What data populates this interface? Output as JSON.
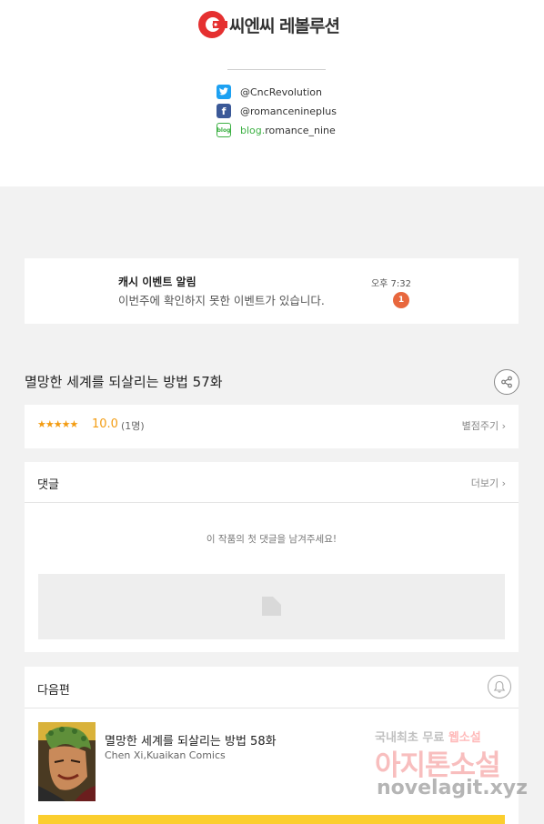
{
  "header": {
    "logo_text": "씨엔씨 레볼루션",
    "social": [
      {
        "icon": "twitter-icon",
        "handle": "@CncRevolution"
      },
      {
        "icon": "facebook-icon",
        "handle": "@romanceninepIus"
      },
      {
        "icon": "blog-icon",
        "prefix": "blog.",
        "handle": "romance_nine"
      }
    ],
    "blog_icon_label": "blog"
  },
  "notification": {
    "title": "캐시 이벤트 알림",
    "body": "이번주에 확인하지 못한 이벤트가 있습니다.",
    "time": "오후 7:32",
    "badge": "1"
  },
  "episode": {
    "title": "멸망한 세계를 되살리는 방법 57화"
  },
  "rating": {
    "stars": "★★★★★",
    "score": "10.0",
    "count": "(1명)",
    "rate_label": "별점주기 ›"
  },
  "comments": {
    "title": "댓글",
    "more_label": "더보기 ›",
    "empty_message": "이 작품의 첫 댓글을 남겨주세요!"
  },
  "next_episode": {
    "section_title": "다음편",
    "title": "멸망한 세계를 되살리는 방법 58화",
    "authors": "Chen Xi,Kuaikan Comics"
  },
  "watermark": {
    "line1_a": "국내최초 무료",
    "line1_b": "웹소설",
    "line2": "아지톤소설",
    "line3": "novelagit.xyz"
  },
  "colors": {
    "accent_orange": "#e8673d",
    "star_orange": "#f39c12",
    "brand_red": "#e53030",
    "next_bar_yellow": "#fbce2e",
    "twitter_blue": "#1da1f2",
    "facebook_blue": "#3b5998"
  }
}
